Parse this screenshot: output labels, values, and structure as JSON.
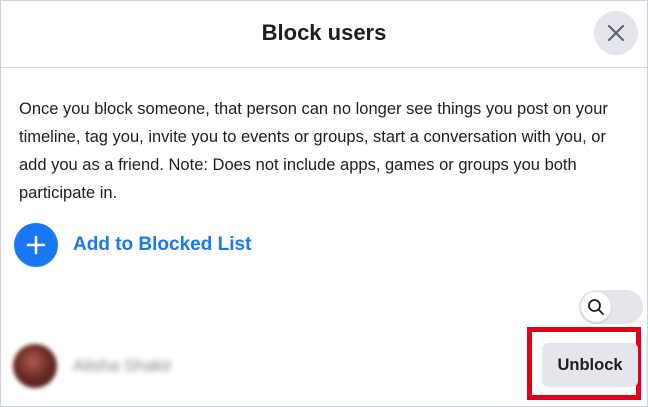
{
  "dialog": {
    "title": "Block users",
    "close_icon": "close-icon",
    "description": "Once you block someone, that person can no longer see things you post on your timeline, tag you, invite you to events or groups, start a conversation with you, or add you as a friend. Note: Does not include apps, games or groups you both participate in.",
    "add_to_blocked_label": "Add to Blocked List",
    "add_icon": "plus-icon",
    "search_icon": "search-icon"
  },
  "blocked_users": [
    {
      "name": "Alisha Shakir",
      "action_label": "Unblock"
    }
  ],
  "colors": {
    "accent": "#1877f2",
    "button_bg": "#e4e6eb",
    "highlight": "#e4001b"
  }
}
